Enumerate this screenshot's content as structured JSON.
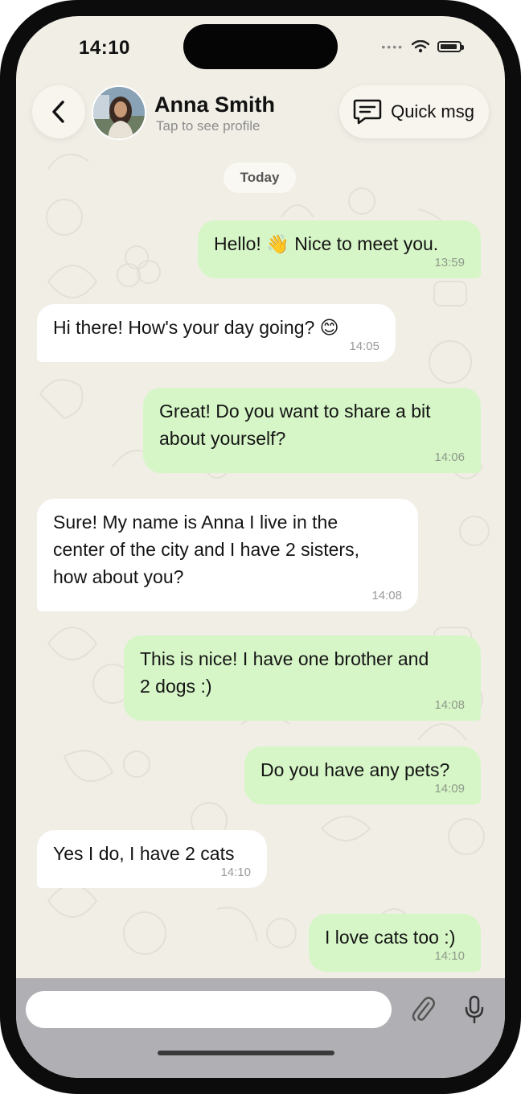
{
  "status_bar": {
    "time": "14:10"
  },
  "header": {
    "contact_name": "Anna Smith",
    "subtitle": "Tap to see profile",
    "quick_msg_label": "Quick msg",
    "back_icon": "chevron-left-icon",
    "quick_icon": "chat-bubble-icon"
  },
  "date_separator": "Today",
  "messages": [
    {
      "direction": "out",
      "text": "Hello! 👋 Nice to meet you.",
      "time": "13:59"
    },
    {
      "direction": "in",
      "text": "Hi there! How's your day going? 😊",
      "time": "14:05"
    },
    {
      "direction": "out",
      "text": "Great! Do you want to share a bit\nabout yourself?",
      "time": "14:06"
    },
    {
      "direction": "in",
      "text": "Sure! My name is Anna I live in the\ncenter of the city and I have 2 sisters,\nhow about you?",
      "time": "14:08"
    },
    {
      "direction": "out",
      "text": "This is nice! I have one brother and\n2 dogs :)",
      "time": "14:08"
    },
    {
      "direction": "out",
      "text": "Do you have any pets?",
      "time": "14:09"
    },
    {
      "direction": "in",
      "text": "Yes I do, I have 2 cats",
      "time": "14:10"
    },
    {
      "direction": "out",
      "text": "I love cats too :)",
      "time": "14:10"
    }
  ],
  "composer": {
    "value": "",
    "attach_icon": "paperclip-icon",
    "mic_icon": "microphone-icon"
  },
  "colors": {
    "outgoing_bubble": "#d6f6c7",
    "incoming_bubble": "#ffffff",
    "chat_background": "#f1eee6",
    "composer_bar": "#b0afb4"
  }
}
